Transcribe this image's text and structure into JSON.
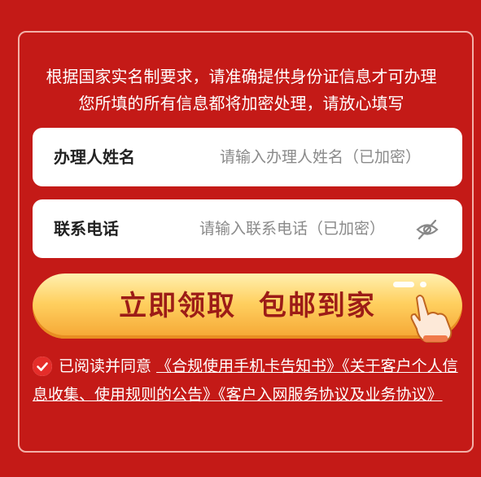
{
  "intro": {
    "line1": "根据国家实名制要求，请准确提供身份证信息才可办理",
    "line2": "您所填的所有信息都将加密处理，请放心填写"
  },
  "form": {
    "name_label": "办理人姓名",
    "name_placeholder": "请输入办理人姓名（已加密）",
    "phone_label": "联系电话",
    "phone_placeholder": "请输入联系电话（已加密）"
  },
  "cta": {
    "label": "立即领取  包邮到家"
  },
  "agreement": {
    "prefix": "已阅读并同意",
    "doc1": "《合规使用手机卡告知书》",
    "doc2": "《关于客户个人信息收集、使用规则的公告》",
    "doc3": "《客户入网服务协议及业务协议》",
    "checked": true
  },
  "colors": {
    "background": "#c41a17",
    "button_text": "#9c1c17",
    "check": "#e52d2a"
  }
}
